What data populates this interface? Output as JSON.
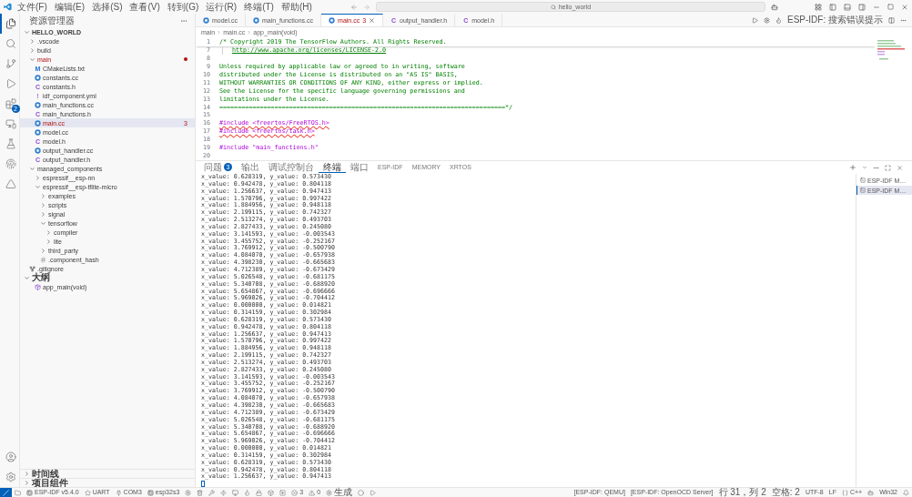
{
  "menu": [
    "文件(F)",
    "编辑(E)",
    "选择(S)",
    "查看(V)",
    "转到(G)",
    "运行(R)",
    "终端(T)",
    "帮助(H)"
  ],
  "search": {
    "value": "hello_world"
  },
  "activity_bar": {
    "items": [
      {
        "kind": "files",
        "selected": true
      },
      {
        "kind": "search",
        "selected": false
      },
      {
        "kind": "source-control",
        "selected": false
      },
      {
        "kind": "run-debug",
        "selected": false
      },
      {
        "kind": "extensions",
        "selected": false,
        "badge": "2"
      },
      {
        "kind": "remote",
        "selected": false
      },
      {
        "kind": "testing",
        "selected": false
      },
      {
        "kind": "esp-idf",
        "selected": false
      },
      {
        "kind": "triangle",
        "selected": false
      }
    ],
    "bottom": [
      {
        "kind": "account"
      },
      {
        "kind": "settings"
      }
    ]
  },
  "sidebar": {
    "title": "资源管理器",
    "tree": {
      "label": "HELLO_WORLD",
      "expanded": true,
      "children": [
        {
          "label": ".vscode",
          "kind": "folder",
          "expanded": false,
          "selected": false,
          "error": false
        },
        {
          "label": "build",
          "kind": "folder",
          "expanded": false,
          "selected": false,
          "error": false
        },
        {
          "label": "main",
          "kind": "folder",
          "expanded": true,
          "selected": false,
          "error": true,
          "children": [
            {
              "label": "CMakeLists.txt",
              "kind": "cmake",
              "glyph": "M",
              "selected": false,
              "error": false
            },
            {
              "label": "constants.cc",
              "kind": "cpp",
              "selected": false,
              "error": false
            },
            {
              "label": "constants.h",
              "kind": "header",
              "glyph": "C",
              "selected": false,
              "error": false
            },
            {
              "label": "idf_component.yml",
              "kind": "yaml",
              "glyph": "!",
              "selected": false,
              "error": false
            },
            {
              "label": "main_functions.cc",
              "kind": "cpp",
              "selected": false,
              "error": false
            },
            {
              "label": "main_functions.h",
              "kind": "header",
              "glyph": "C",
              "selected": false,
              "error": false
            },
            {
              "label": "main.cc",
              "kind": "cpp",
              "selected": true,
              "error": true,
              "problems": "3"
            },
            {
              "label": "model.cc",
              "kind": "cpp",
              "selected": false,
              "error": false
            },
            {
              "label": "model.h",
              "kind": "header",
              "glyph": "C",
              "selected": false,
              "error": false
            },
            {
              "label": "output_handler.cc",
              "kind": "cpp",
              "selected": false,
              "error": false
            },
            {
              "label": "output_handler.h",
              "kind": "header",
              "glyph": "C",
              "selected": false,
              "error": false
            }
          ]
        },
        {
          "label": "managed_components",
          "kind": "folder",
          "expanded": true,
          "selected": false,
          "error": false,
          "children": [
            {
              "label": "espressif__esp-nn",
              "kind": "folder",
              "expanded": false,
              "selected": false,
              "error": false
            },
            {
              "label": "espressif__esp-tflite-micro",
              "kind": "folder",
              "expanded": true,
              "selected": false,
              "error": false,
              "children": [
                {
                  "label": "examples",
                  "kind": "folder",
                  "expanded": false,
                  "selected": false,
                  "error": false
                },
                {
                  "label": "scripts",
                  "kind": "folder",
                  "expanded": false,
                  "selected": false,
                  "error": false
                },
                {
                  "label": "signal",
                  "kind": "folder",
                  "expanded": false,
                  "selected": false,
                  "error": false
                },
                {
                  "label": "tensorflow",
                  "kind": "folder",
                  "expanded": true,
                  "selected": false,
                  "error": false,
                  "children": [
                    {
                      "label": "compiler",
                      "kind": "folder",
                      "expanded": false,
                      "selected": false,
                      "error": false
                    },
                    {
                      "label": "lite",
                      "kind": "folder",
                      "expanded": false,
                      "selected": false,
                      "error": false
                    }
                  ]
                },
                {
                  "label": "third_party",
                  "kind": "folder",
                  "expanded": false,
                  "selected": false,
                  "error": false
                },
                {
                  "label": ".component_hash",
                  "kind": "hash",
                  "selected": false,
                  "error": false
                }
              ]
            }
          ]
        },
        {
          "label": ".gitignore",
          "kind": "git",
          "selected": false,
          "error": false
        }
      ]
    },
    "outline": {
      "title": "大纲",
      "expanded": true,
      "items": [
        {
          "label": "app_main(void)"
        }
      ]
    },
    "sections": [
      {
        "title": "时间线",
        "expanded": false
      },
      {
        "title": "项目组件",
        "expanded": false
      }
    ]
  },
  "tabs": [
    {
      "label": "model.cc",
      "kind": "cpp",
      "selected": false
    },
    {
      "label": "main_functions.cc",
      "kind": "cpp",
      "selected": false
    },
    {
      "label": "main.cc",
      "kind": "cpp",
      "selected": true,
      "problems": "3"
    },
    {
      "label": "output_handler.h",
      "kind": "header",
      "glyph": "C",
      "selected": false
    },
    {
      "label": "model.h",
      "kind": "header",
      "glyph": "C",
      "selected": false
    }
  ],
  "editor_actions": {
    "label": "ESP-IDF: 搜索错误提示"
  },
  "breadcrumbs": [
    "main",
    "main.cc",
    "app_main(void)"
  ],
  "code": [
    {
      "line": "1",
      "kind": "comment",
      "text": "/* Copyright 2019 The TensorFlow Authors. All Rights Reserved."
    },
    {
      "line": "7",
      "kind": "link",
      "text": "http://www.apache.org/licenses/LICENSE-2.0"
    },
    {
      "line": "8",
      "kind": "blank"
    },
    {
      "line": "9",
      "kind": "comment",
      "text": "Unless required by applicable law or agreed to in writing, software"
    },
    {
      "line": "10",
      "kind": "comment",
      "text": "distributed under the License is distributed on an \"AS IS\" BASIS,"
    },
    {
      "line": "11",
      "kind": "comment",
      "text": "WITHOUT WARRANTIES OR CONDITIONS OF ANY KIND, either express or implied."
    },
    {
      "line": "12",
      "kind": "comment",
      "text": "See the License for the specific language governing permissions and"
    },
    {
      "line": "13",
      "kind": "comment",
      "text": "limitations under the License."
    },
    {
      "line": "14",
      "kind": "comment",
      "text": "==============================================================================*/"
    },
    {
      "line": "15",
      "kind": "blank"
    },
    {
      "line": "16",
      "kind": "include",
      "text": "#include <freertos/FreeRTOS.h>",
      "squiggle": true
    },
    {
      "line": "17",
      "kind": "include",
      "text": "#include <freertos/task.h>",
      "squiggle": true
    },
    {
      "line": "18",
      "kind": "blank"
    },
    {
      "line": "19",
      "kind": "include",
      "text": "#include \"main_functions.h\"",
      "squiggle": false
    },
    {
      "line": "20",
      "kind": "blank"
    }
  ],
  "panel": {
    "tabs": [
      {
        "label": "问题",
        "badge": "3",
        "selected": false
      },
      {
        "label": "输出",
        "selected": false
      },
      {
        "label": "调试控制台",
        "selected": false
      },
      {
        "label": "终端",
        "selected": true
      },
      {
        "label": "端口",
        "selected": false
      },
      {
        "label": "ESP-IDF",
        "selected": false
      },
      {
        "label": "MEMORY",
        "selected": false
      },
      {
        "label": "XRTOS",
        "selected": false
      }
    ],
    "output": [
      "x_value: 0.628319, y_value: 0.573430",
      "x_value: 0.942478, y_value: 0.804118",
      "x_value: 1.256637, y_value: 0.947413",
      "x_value: 1.570796, y_value: 0.997422",
      "x_value: 1.884956, y_value: 0.948118",
      "x_value: 2.199115, y_value: 0.742327",
      "x_value: 2.513274, y_value: 0.493703",
      "x_value: 2.827433, y_value: 0.245080",
      "x_value: 3.141593, y_value: -0.003543",
      "x_value: 3.455752, y_value: -0.252167",
      "x_value: 3.769912, y_value: -0.500790",
      "x_value: 4.084070, y_value: -0.657938",
      "x_value: 4.398230, y_value: -0.665683",
      "x_value: 4.712389, y_value: -0.673429",
      "x_value: 5.026548, y_value: -0.681175",
      "x_value: 5.340708, y_value: -0.688920",
      "x_value: 5.654867, y_value: -0.696666",
      "x_value: 5.969026, y_value: -0.704412",
      "x_value: 0.000000, y_value: 0.014821",
      "x_value: 0.314159, y_value: 0.302984",
      "x_value: 0.628319, y_value: 0.573430",
      "x_value: 0.942478, y_value: 0.804118",
      "x_value: 1.256637, y_value: 0.947413",
      "x_value: 1.570796, y_value: 0.997422",
      "x_value: 1.884956, y_value: 0.948118",
      "x_value: 2.199115, y_value: 0.742327",
      "x_value: 2.513274, y_value: 0.493703",
      "x_value: 2.827433, y_value: 0.245080",
      "x_value: 3.141593, y_value: -0.003543",
      "x_value: 3.455752, y_value: -0.252167",
      "x_value: 3.769912, y_value: -0.500790",
      "x_value: 4.084070, y_value: -0.657938",
      "x_value: 4.398230, y_value: -0.665683",
      "x_value: 4.712389, y_value: -0.673429",
      "x_value: 5.026548, y_value: -0.681175",
      "x_value: 5.340708, y_value: -0.688920",
      "x_value: 5.654867, y_value: -0.696666",
      "x_value: 5.969026, y_value: -0.704412",
      "x_value: 0.000000, y_value: 0.014821",
      "x_value: 0.314159, y_value: 0.302984",
      "x_value: 0.628319, y_value: 0.573430",
      "x_value: 0.942478, y_value: 0.804118",
      "x_value: 1.256637, y_value: 0.947413"
    ],
    "terminals": [
      {
        "label": "ESP-IDF M…",
        "selected": false
      },
      {
        "label": "ESP-IDF M…",
        "selected": true
      }
    ]
  },
  "status_bar": {
    "left": [
      {
        "kind": "remote"
      },
      {
        "kind": "folder"
      },
      {
        "kind": "chip",
        "text": "ESP-IDF v5.4.0"
      },
      {
        "kind": "star",
        "text": "UART"
      },
      {
        "kind": "plug",
        "text": "COM3"
      },
      {
        "kind": "chip",
        "text": "esp32s3"
      },
      {
        "kind": "gear"
      },
      {
        "kind": "trash"
      },
      {
        "kind": "wrench"
      },
      {
        "kind": "flash"
      },
      {
        "kind": "monitor"
      },
      {
        "kind": "flame"
      },
      {
        "kind": "lock"
      },
      {
        "kind": "box"
      },
      {
        "kind": "square-plus"
      },
      {
        "kind": "error",
        "text": "3"
      },
      {
        "kind": "warning",
        "text": "0"
      },
      {
        "kind": "gear",
        "text": "生成"
      },
      {
        "kind": "circle"
      },
      {
        "kind": "play"
      }
    ],
    "right": [
      {
        "text": "[ESP-IDF: QEMU]"
      },
      {
        "text": "[ESP-IDF: OpenOCD Server]"
      },
      {
        "text": "行 31，列 2"
      },
      {
        "text": "空格: 2"
      },
      {
        "text": "UTF-8"
      },
      {
        "text": "LF"
      },
      {
        "kind": "braces",
        "text": "C++"
      },
      {
        "kind": "bot"
      },
      {
        "text": "Win32"
      },
      {
        "kind": "bell"
      }
    ]
  }
}
